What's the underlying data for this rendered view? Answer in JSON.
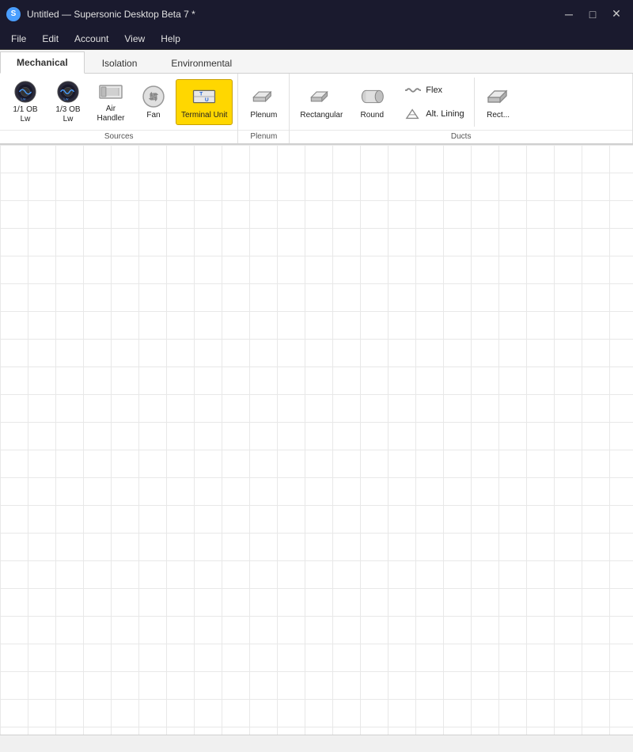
{
  "titleBar": {
    "appIcon": "S",
    "title": "Untitled — Supersonic Desktop Beta 7 *",
    "controls": {
      "minimize": "─",
      "maximize": "□",
      "close": "✕"
    }
  },
  "menuBar": {
    "items": [
      "File",
      "Edit",
      "Account",
      "View",
      "Help"
    ]
  },
  "ribbonTabs": {
    "tabs": [
      {
        "id": "mechanical",
        "label": "Mechanical",
        "active": true
      },
      {
        "id": "isolation",
        "label": "Isolation",
        "active": false
      },
      {
        "id": "environmental",
        "label": "Environmental",
        "active": false
      }
    ]
  },
  "ribbonGroups": {
    "sources": {
      "label": "Sources",
      "items": [
        {
          "id": "ob1",
          "label": "1/1 OB\nLw",
          "active": false
        },
        {
          "id": "ob13",
          "label": "1/3 OB\nLw",
          "active": false
        },
        {
          "id": "airhandler",
          "label": "Air\nHandler",
          "active": false
        },
        {
          "id": "fan",
          "label": "Fan",
          "active": false
        },
        {
          "id": "terminalunit",
          "label": "Terminal Unit",
          "active": true
        }
      ]
    },
    "plenum": {
      "label": "Plenum",
      "items": [
        {
          "id": "plenum",
          "label": "Plenum",
          "active": false
        }
      ]
    },
    "ducts": {
      "label": "Ducts",
      "mainItems": [
        {
          "id": "rectangular",
          "label": "Rectangular",
          "active": false
        },
        {
          "id": "round",
          "label": "Round",
          "active": false
        }
      ],
      "sideItems": [
        {
          "id": "flex",
          "label": "Flex"
        },
        {
          "id": "altlining",
          "label": "Alt. Lining"
        }
      ],
      "overflowLabel": "Rect..."
    }
  },
  "canvas": {
    "gridSize": 35
  },
  "statusBar": {
    "text": ""
  }
}
